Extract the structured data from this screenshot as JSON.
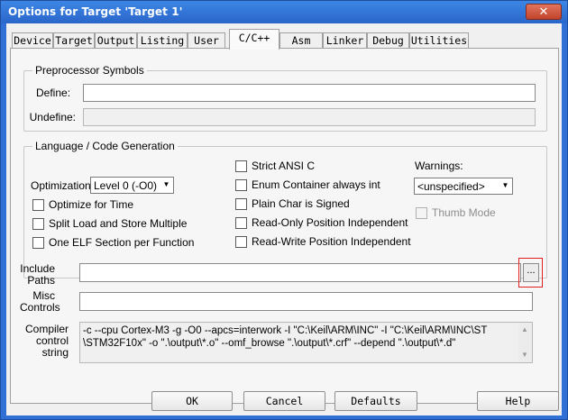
{
  "window": {
    "title": "Options for Target 'Target 1'",
    "close_glyph": "✕"
  },
  "tabs": [
    "Device",
    "Target",
    "Output",
    "Listing",
    "User",
    "C/C++",
    "Asm",
    "Linker",
    "Debug",
    "Utilities"
  ],
  "active_tab": "C/C++",
  "preprocessor": {
    "group_label": "Preprocessor Symbols",
    "define_label": "Define:",
    "define_value": "",
    "undefine_label": "Undefine:",
    "undefine_value": ""
  },
  "language": {
    "group_label": "Language / Code Generation",
    "optimization_label": "Optimization:",
    "optimization_value": "Level 0 (-O0)",
    "checkboxes_left": [
      {
        "label": "Optimize for Time",
        "checked": false
      },
      {
        "label": "Split Load and Store Multiple",
        "checked": false
      },
      {
        "label": "One ELF Section per Function",
        "checked": false
      }
    ],
    "checkboxes_middle": [
      {
        "label": "Strict ANSI C",
        "checked": false
      },
      {
        "label": "Enum Container always int",
        "checked": false
      },
      {
        "label": "Plain Char is Signed",
        "checked": false
      },
      {
        "label": "Read-Only Position Independent",
        "checked": false
      },
      {
        "label": "Read-Write Position Independent",
        "checked": false
      }
    ],
    "warnings_label": "Warnings:",
    "warnings_value": "<unspecified>",
    "thumb_mode_label": "Thumb Mode",
    "thumb_mode_checked": false
  },
  "include": {
    "label_line1": "Include",
    "label_line2": "Paths",
    "value": "",
    "browse_label": "..."
  },
  "misc": {
    "label_line1": "Misc",
    "label_line2": "Controls",
    "value": ""
  },
  "compiler": {
    "label_line1": "Compiler",
    "label_line2": "control",
    "label_line3": "string",
    "line1": "-c --cpu Cortex-M3 -g -O0 --apcs=interwork -I \"C:\\Keil\\ARM\\INC\" -I \"C:\\Keil\\ARM\\INC\\ST",
    "line2": "\\STM32F10x\" -o \".\\output\\*.o\" --omf_browse \".\\output\\*.crf\" --depend \".\\output\\*.d\""
  },
  "buttons": {
    "ok": "OK",
    "cancel": "Cancel",
    "defaults": "Defaults",
    "help": "Help"
  },
  "colors": {
    "title_bar": "#2a66c9",
    "highlight": "#e02020",
    "dialog_bg": "#f0f0f0"
  }
}
